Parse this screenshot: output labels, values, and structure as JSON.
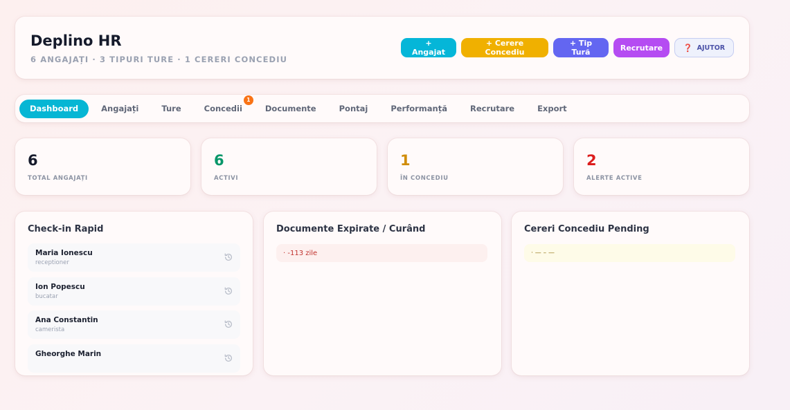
{
  "header": {
    "title": "Deplino HR",
    "subtitle": "6 ANGAJAȚI · 3 TIPURI TURE · 1 CERERI CONCEDIU",
    "actions": {
      "add_employee": "+ Angajat",
      "leave_request": "+ Cerere Concediu",
      "shift_type": "+ Tip Tură",
      "recruit": "Recrutare",
      "help": "AJUTOR"
    },
    "colors": {
      "employee": "#05b6d8",
      "leave": "#f0b000",
      "shift": "#6366f1",
      "recruit": "#b54cf2"
    }
  },
  "tabs": [
    {
      "label": "Dashboard",
      "active": true
    },
    {
      "label": "Angajați"
    },
    {
      "label": "Ture"
    },
    {
      "label": "Concedii",
      "badge": "1"
    },
    {
      "label": "Documente"
    },
    {
      "label": "Pontaj"
    },
    {
      "label": "Performanță"
    },
    {
      "label": "Recrutare"
    },
    {
      "label": "Export"
    }
  ],
  "stats": [
    {
      "value": "6",
      "label": "TOTAL ANGAJAȚI",
      "color": "#151a2b"
    },
    {
      "value": "6",
      "label": "ACTIVI",
      "color": "#079669"
    },
    {
      "value": "1",
      "label": "ÎN CONCEDIU",
      "color": "#d08c08"
    },
    {
      "value": "2",
      "label": "ALERTE ACTIVE",
      "color": "#dc1d1d"
    }
  ],
  "checkin": {
    "title": "Check-in Rapid",
    "items": [
      {
        "name": "Maria Ionescu",
        "role": "receptioner",
        "icon": "history-icon"
      },
      {
        "name": "Ion Popescu",
        "role": "bucatar",
        "icon": "history-icon"
      },
      {
        "name": "Ana Constantin",
        "role": "camerista",
        "icon": "history-icon"
      },
      {
        "name": "Gheorghe Marin",
        "role": "",
        "icon": "history-icon"
      }
    ]
  },
  "documents": {
    "title": "Documente Expirate / Curând",
    "items": [
      {
        "text": "· -113 zile"
      }
    ]
  },
  "leave": {
    "title": "Cereri Concediu Pending",
    "items": [
      {
        "text": "· — – —"
      }
    ]
  }
}
